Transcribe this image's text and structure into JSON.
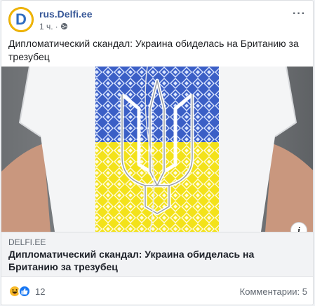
{
  "post": {
    "page_name": "rus.Delfi.ee",
    "avatar_letter": "D",
    "time": "1 ч.",
    "separator": "·",
    "text": "Дипломатический скандал: Украина обиделась на Британию за трезубец",
    "link": {
      "domain": "DELFI.EE",
      "title": "Дипломатический скандал: Украина обиделась на Британию за трезубец"
    },
    "reactions": {
      "icons": [
        "haha-icon",
        "like-icon"
      ],
      "count": "12"
    },
    "comments_label": "Комментарии: 5",
    "info_label": "i"
  },
  "colors": {
    "brand_blue": "#385898",
    "ukraine_blue": "#3b5fc6",
    "ukraine_yellow": "#f3e21a",
    "like_blue": "#1877f2",
    "haha_yellow": "#f7b928"
  }
}
